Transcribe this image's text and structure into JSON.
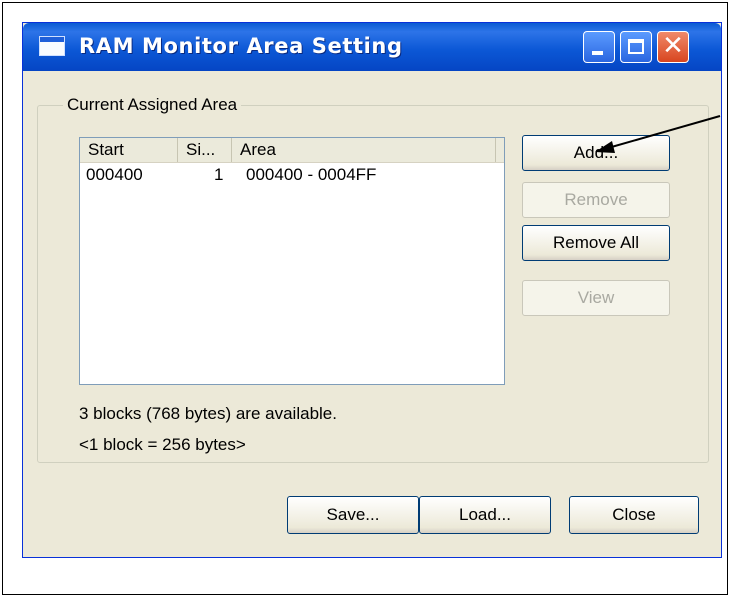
{
  "window": {
    "title": "RAM Monitor Area Setting",
    "controls": [
      "minimize-icon",
      "maximize-icon",
      "close-icon"
    ]
  },
  "group": {
    "label": "Current Assigned Area"
  },
  "list": {
    "columns": [
      "Start",
      "Si...",
      "Area"
    ],
    "rows": [
      {
        "start": "000400",
        "size": "1",
        "area": "000400 - 0004FF"
      }
    ]
  },
  "side_buttons": {
    "add": "Add...",
    "remove": "Remove",
    "remove_all": "Remove All",
    "view": "View"
  },
  "info": {
    "available": "3 blocks (768 bytes) are available.",
    "block_size": "<1 block = 256 bytes>"
  },
  "bottom_buttons": {
    "save": "Save...",
    "load": "Load...",
    "close": "Close"
  },
  "colors": {
    "titlebar": "#0a5bd3",
    "window_bg": "#ece9d8",
    "disabled_text": "#a9a9a1"
  }
}
